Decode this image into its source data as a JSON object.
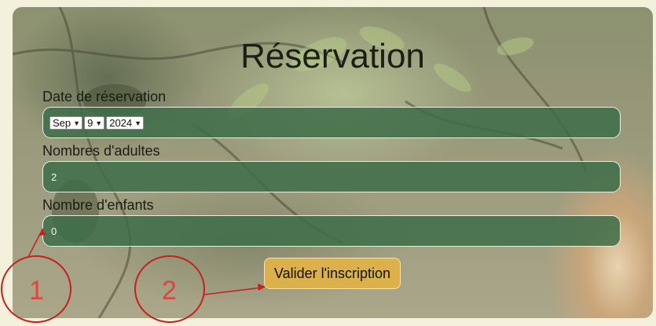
{
  "form": {
    "title": "Réservation",
    "date_label": "Date de réservation",
    "date_month": "Sep",
    "date_day": "9",
    "date_year": "2024",
    "adults_label": "Nombres d'adultes",
    "adults_value": "2",
    "children_label": "Nombre d'enfants",
    "children_value": "0",
    "submit_label": "Valider l'inscription"
  },
  "annotations": {
    "marker_1": "1",
    "marker_2": "2",
    "color": "#c81e1e"
  },
  "colors": {
    "field_bg": "#3e6e48",
    "button_bg": "#dcb04a",
    "page_bg": "#f3f1dc"
  }
}
